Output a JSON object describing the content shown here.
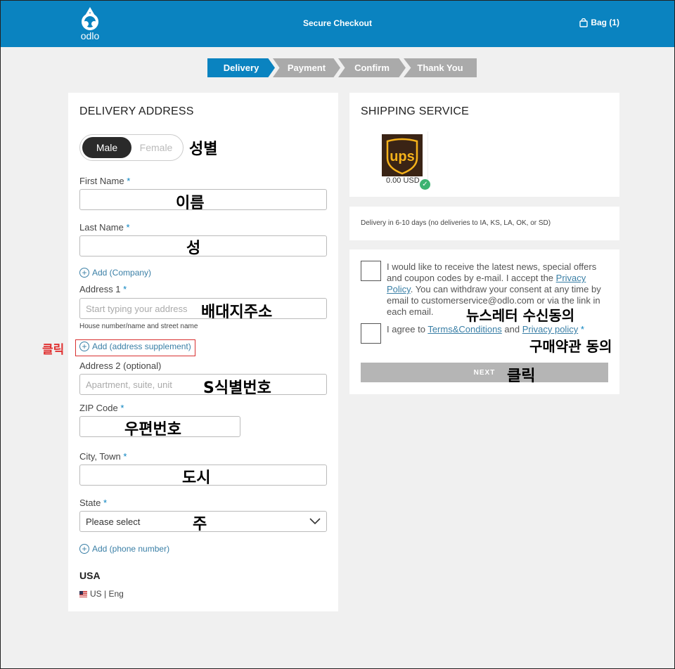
{
  "header": {
    "logo_text": "odlo",
    "title": "Secure Checkout",
    "bag_label": "Bag (1)"
  },
  "steps": [
    "Delivery",
    "Payment",
    "Confirm",
    "Thank You"
  ],
  "delivery": {
    "title": "DELIVERY ADDRESS",
    "gender": {
      "male": "Male",
      "female": "Female",
      "selected": "Male"
    },
    "first_name_label": "First Name",
    "last_name_label": "Last Name",
    "add_company": "Add (Company)",
    "address1_label": "Address 1",
    "address1_placeholder": "Start typing your address",
    "address1_hint": "House number/name and street name",
    "add_address_supplement": "Add (address supplement)",
    "address2_label": "Address 2 (optional)",
    "address2_placeholder": "Apartment, suite, unit",
    "zip_label": "ZIP Code",
    "city_label": "City, Town",
    "state_label": "State",
    "state_value": "Please select",
    "add_phone": "Add (phone number)",
    "country": "USA",
    "locale": "US | Eng",
    "required_mark": "*"
  },
  "shipping": {
    "title": "SHIPPING SERVICE",
    "carrier_icon": "ups-logo",
    "price": "0.00 USD",
    "delivery_text": "Delivery in 6-10 days (no deliveries to IA, KS, LA, OK, or SD)"
  },
  "consent": {
    "newsletter_pre": "I would like to receive the latest news, special offers and coupon codes by e-mail. I accept the ",
    "newsletter_link": "Privacy Policy",
    "newsletter_post": ". You can withdraw your consent at any time by email to customerservice@odlo.com or via the link in each email.",
    "terms_pre": "I agree to ",
    "terms_link": "Terms&Conditions",
    "terms_mid": " and ",
    "privacy_link": "Privacy policy",
    "terms_req": " *",
    "next_label": "NEXT"
  },
  "annotations": {
    "gender": "성별",
    "first_name": "이름",
    "last_name": "성",
    "address": "배대지주소",
    "click_left": "클릭",
    "address2": "S식별번호",
    "zip": "우편번호",
    "city": "도시",
    "state": "주",
    "newsletter": "뉴스레터 수신동의",
    "terms": "구매약관 동의",
    "click_next": "클릭"
  },
  "colors": {
    "brand": "#0a83c0",
    "link": "#3a7fa6",
    "annotation_red": "#e03030"
  }
}
